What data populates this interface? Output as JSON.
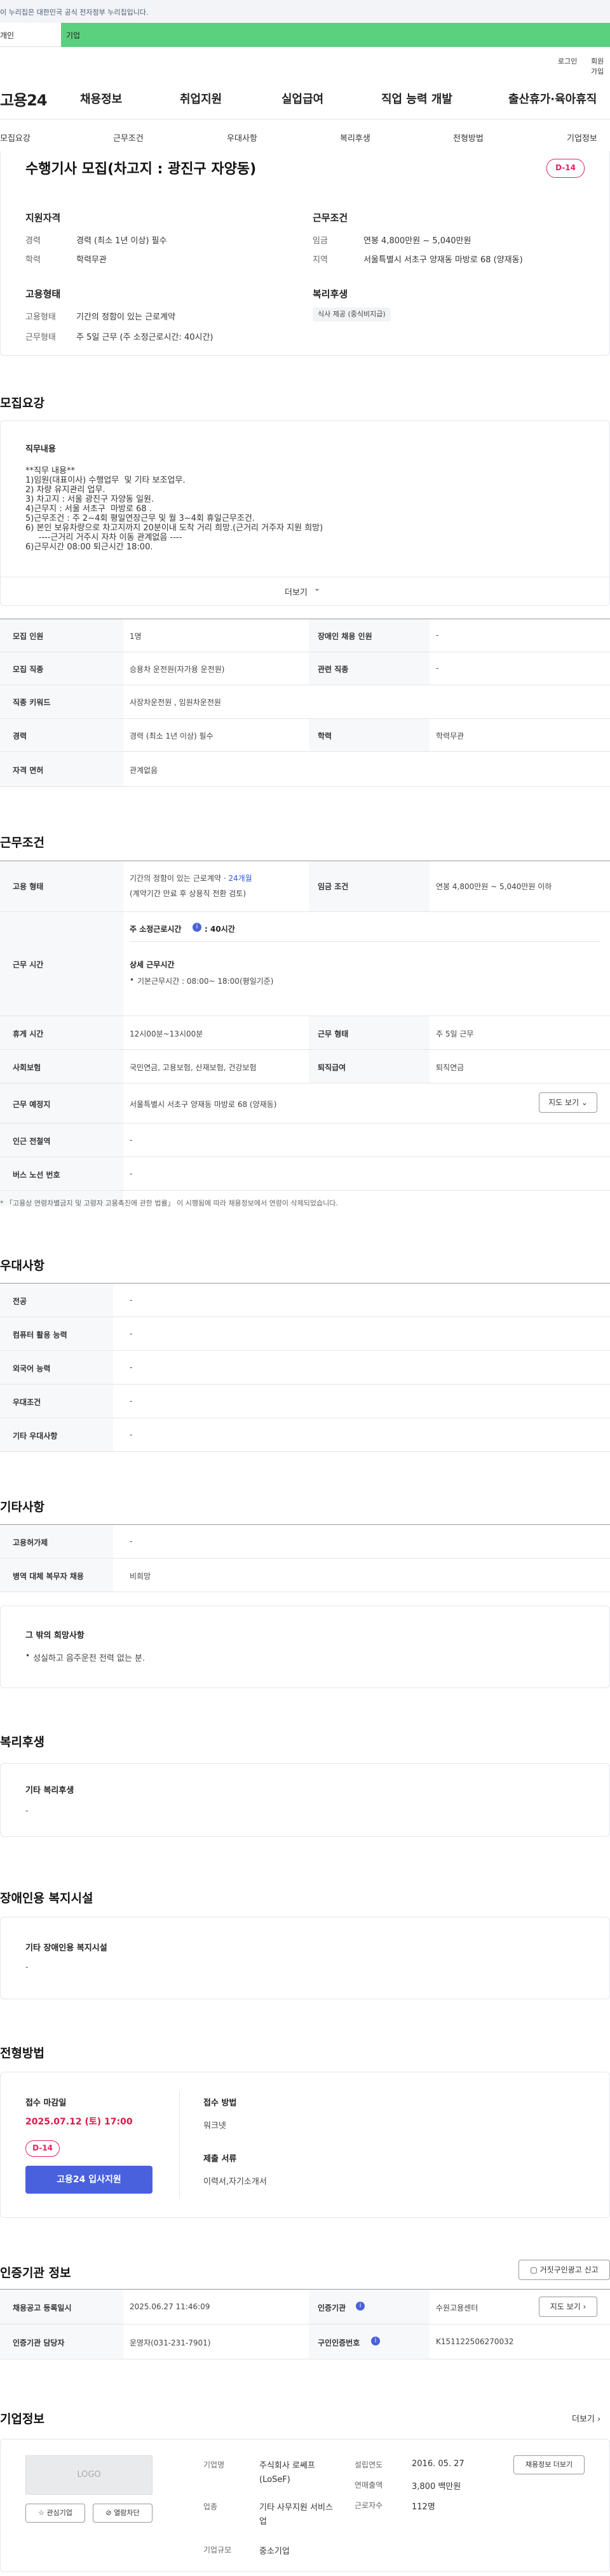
{
  "notice_bar": "이 누리집은 대한민국 공식 전자정부 누리집입니다.",
  "service_tabs": [
    "개인",
    "기업"
  ],
  "util": {
    "login": "로그인",
    "signup": "회원가입"
  },
  "brand": "고용24",
  "gnb": [
    "채용정보",
    "취업지원",
    "실업급여",
    "직업 능력 개발",
    "출산휴가·육아휴직"
  ],
  "subnav": [
    "모집요강",
    "근무조건",
    "우대사항",
    "복리후생",
    "전형방법",
    "기업정보"
  ],
  "job": {
    "title": "수행기사 모집(차고지 : 광진구 자양동)",
    "dday": "D-14",
    "qual_title": "지원자격",
    "cond_title": "근무조건",
    "emp_title": "고용형태",
    "welfare_title": "복리후생",
    "qual": [
      {
        "label": "경력",
        "value": "경력 (최소 1년 이상) 필수"
      },
      {
        "label": "학력",
        "value": "학력무관"
      }
    ],
    "cond": [
      {
        "label": "임금",
        "value": "연봉 4,800만원 ~ 5,040만원"
      },
      {
        "label": "지역",
        "value": "서울특별시 서초구 양재동 마방로 68 (양재동)"
      }
    ],
    "emp": [
      {
        "label": "고용형태",
        "value": "기간의 정함이 있는 근로계약"
      },
      {
        "label": "근무형태",
        "value": "주 5일 근무 (주 소정근로시간: 40시간)"
      }
    ],
    "welfare_chip": "식사 제공 (중식비지급)"
  },
  "recruit": {
    "section": "모집요강",
    "box_title": "직무내용",
    "content": "**직무 내용**\n1)임원(대표이사) 수행업무  및 기타 보조업무.\n2) 차량 유지관리 업무.\n3) 차고지 : 서울 광진구 자양동 일원.\n4)근무지 : 서울 서초구  마방로 68 .\n5)근무조건 : 주 2~4회 평일연장근무 및 월 3~4회 휴일근무조건.\n6) 본인 보유차량으로 차고지까지 20분이내 도착 거리 희망.(근거리 거주자 지원 희망)\n     ----근거리 거주시 자차 이동 관계없음 ----\n6)근무시간 08:00 퇴근시간 18:00.",
    "more": "더보기",
    "table": {
      "r1": [
        "모집 인원",
        "1명",
        "장애인 채용 인원",
        "-"
      ],
      "r2": [
        "모집 직종",
        "승용차 운전원(자가용 운전원)",
        "관련 직종",
        "-"
      ],
      "r3": [
        "직종 키워드",
        "사장차운전원 , 임원차운전원"
      ],
      "r4": [
        "경력",
        "경력 (최소 1년 이상) 필수",
        "학력",
        "학력무관"
      ],
      "r5": [
        "자격 면허",
        "관계없음"
      ]
    }
  },
  "work": {
    "section": "근무조건",
    "emp_label": "고용 형태",
    "emp_value": "기간의 정함이 있는 근로계약 · ",
    "emp_months": "24개월",
    "emp_sub": "(계약기간 만료 후 상용직 전환 검토)",
    "wage_label": "임금 조건",
    "wage_value": "연봉 4,800만원 ~ 5,040만원 이하",
    "time_label": "근무 시간",
    "weekly_hours_label": "주 소정근로시간",
    "weekly_hours": ": 40시간",
    "detail_title": "상세 근무시간",
    "detail_item": "기본근무시간 : 08:00~ 18:00(평일기준)",
    "rest_label": "휴게 시간",
    "rest_value": "12시00분~13시00분",
    "type_label": "근무 형태",
    "type_value": "주 5일 근무",
    "ins_label": "사회보험",
    "ins_value": "국민연금, 고용보험, 산재보험, 건강보험",
    "pension_label": "퇴직급여",
    "pension_value": "퇴직연금",
    "place_label": "근무 예정지",
    "place_value": "서울특별시 서초구 양재동 마방로 68 (양재동)",
    "map_btn": "지도 보기",
    "subway_label": "인근 전철역",
    "subway_value": "-",
    "bus_label": "버스 노선 번호",
    "bus_value": "-",
    "notice": "* 「고용상 연령차별금지 및 고령자 고용촉진에 관한 법률」 이 시행됨에 따라 채용정보에서 연령이 삭제되었습니다."
  },
  "pref": {
    "section": "우대사항",
    "rows": [
      [
        "전공",
        "-"
      ],
      [
        "컴퓨터 활용 능력",
        "-"
      ],
      [
        "외국어 능력",
        "-"
      ],
      [
        "우대조건",
        "-"
      ],
      [
        "기타 우대사항",
        "-"
      ]
    ]
  },
  "etc": {
    "section": "기타사항",
    "rows": [
      [
        "고용허가제",
        "-"
      ],
      [
        "병역 대체 복무자 채용",
        "비희망"
      ]
    ],
    "box_title": "그 밖의 희망사항",
    "box_item": "성실하고 음주운전 전력 없는 분."
  },
  "welfare": {
    "section": "복리후생",
    "box_title": "기타 복리후생",
    "box_value": "-"
  },
  "disab": {
    "section": "장애인용 복지시설",
    "box_title": "기타 장애인용 복지시설",
    "box_value": "-"
  },
  "screening": {
    "section": "전형방법",
    "deadline_label": "접수 마감일",
    "deadline": "2025.07.12 (토) 17:00",
    "dday": "D-14",
    "apply_btn": "고용24 입사지원",
    "method_label": "접수 방법",
    "method": "워크넷",
    "docs_label": "제출 서류",
    "docs": "이력서,자기소개서"
  },
  "cert": {
    "section": "인증기관 정보",
    "report_btn": "거짓구인광고 신고",
    "r1": [
      "채용공고 등록일시",
      "2025.06.27 11:46:09",
      "인증기관",
      "수원고용센터"
    ],
    "map_btn": "지도 보기",
    "r2": [
      "인증기관 담당자",
      "운영자(031-231-7901)",
      "구인인증번호",
      "K151122506270032"
    ]
  },
  "company": {
    "section": "기업정보",
    "more": "더보기",
    "logo": "LOGO",
    "fav_btn": "관심기업",
    "block_btn": "열람차단",
    "name_label": "기업명",
    "name": "주식회사 로쎄프(LoSeF)",
    "industry_label": "업종",
    "industry": "기타 사무지원 서비스업",
    "scale_label": "기업규모",
    "scale": "중소기업",
    "founded_label": "설립연도",
    "founded": "2016. 05. 27",
    "sales_label": "연매출액",
    "sales": "3,800 백만원",
    "employees_label": "근로자수",
    "employees": "112명",
    "hire_info_btn": "채용정보 더보기"
  },
  "colors": {
    "accent_green": "#5bd07f",
    "dday_red": "#e0245e",
    "apply_blue": "#4a61dd"
  }
}
